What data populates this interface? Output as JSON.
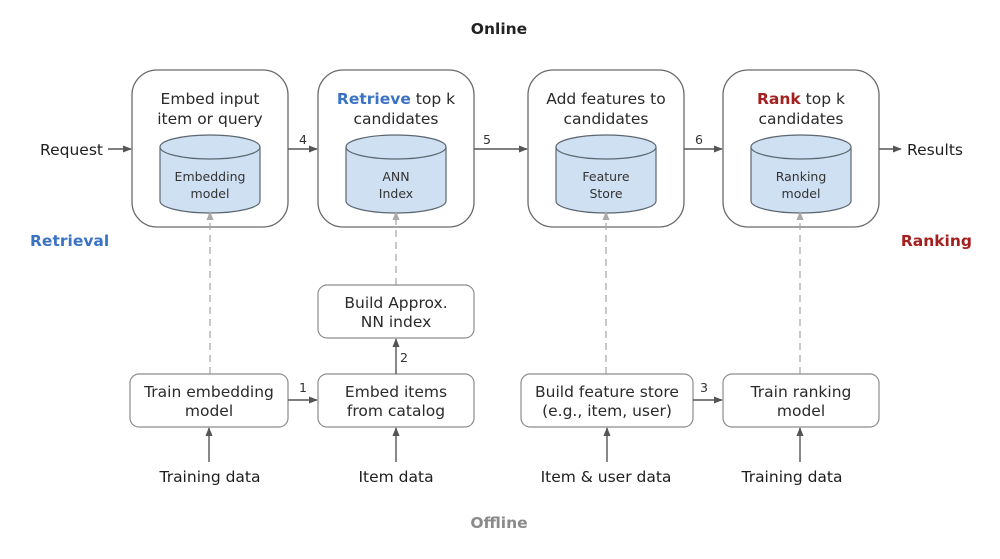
{
  "axes": {
    "online_label": "Online",
    "offline_label": "Offline",
    "retrieval_label": "Retrieval",
    "ranking_label": "Ranking",
    "colors": {
      "retrieval": "#3b73c4",
      "ranking": "#a32020",
      "online_axis_top": "#222222",
      "offline_axis_bottom": "#e0e0e0",
      "offline_label": "#8a8a8a"
    }
  },
  "io": {
    "request": "Request",
    "results": "Results"
  },
  "online_stages": [
    {
      "title_line1_highlight": "",
      "title_line1_rest": "Embed input",
      "title_line2": "item or query",
      "store_line1": "Embedding",
      "store_line2": "model"
    },
    {
      "title_line1_highlight": "Retrieve",
      "title_line1_rest": " top k",
      "title_line2": "candidates",
      "store_line1": "ANN",
      "store_line2": "Index"
    },
    {
      "title_line1_highlight": "",
      "title_line1_rest": "Add features to",
      "title_line2": "candidates",
      "store_line1": "Feature",
      "store_line2": "Store"
    },
    {
      "title_line1_highlight": "Rank",
      "title_line1_rest": " top k",
      "title_line2": "candidates",
      "store_line1": "Ranking",
      "store_line2": "model"
    }
  ],
  "online_step_numbers": [
    "4",
    "5",
    "6"
  ],
  "offline_stages": {
    "train_embedding": {
      "line1": "Train embedding",
      "line2": "model"
    },
    "embed_items": {
      "line1": "Embed items",
      "line2": "from catalog"
    },
    "build_ann": {
      "line1": "Build Approx.",
      "line2": "NN index"
    },
    "build_feature_store": {
      "line1": "Build feature store",
      "line2": "(e.g., item, user)"
    },
    "train_ranking": {
      "line1": "Train ranking",
      "line2": "model"
    }
  },
  "offline_step_numbers": {
    "train_to_embed": "1",
    "embed_to_ann": "2",
    "feature_to_ranking": "3"
  },
  "data_sources": [
    "Training data",
    "Item data",
    "Item & user data",
    "Training data"
  ]
}
